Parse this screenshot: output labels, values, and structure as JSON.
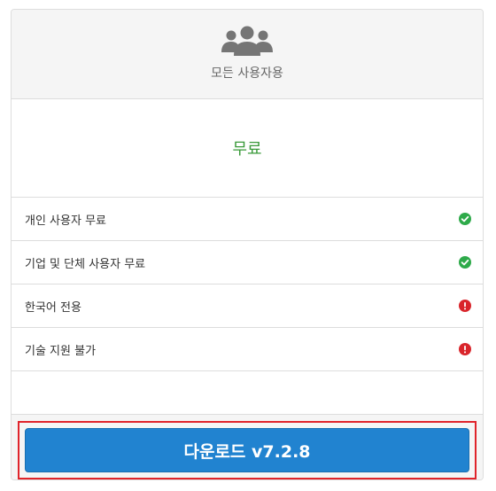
{
  "header": {
    "icon": "users-icon",
    "title": "모든 사용자용"
  },
  "price": {
    "label": "무료",
    "color": "#3a9a3a"
  },
  "features": [
    {
      "label": "개인 사용자 무료",
      "status": "check",
      "icon": "check-circle-icon",
      "color": "#2eaa4a"
    },
    {
      "label": "기업 및 단체 사용자 무료",
      "status": "check",
      "icon": "check-circle-icon",
      "color": "#2eaa4a"
    },
    {
      "label": "한국어 전용",
      "status": "warning",
      "icon": "exclamation-circle-icon",
      "color": "#d9252b"
    },
    {
      "label": "기술 지원 불가",
      "status": "warning",
      "icon": "exclamation-circle-icon",
      "color": "#d9252b"
    }
  ],
  "download": {
    "label": "다운로드 v7.2.8",
    "button_color": "#2183d0",
    "highlight_color": "#e0242b"
  }
}
